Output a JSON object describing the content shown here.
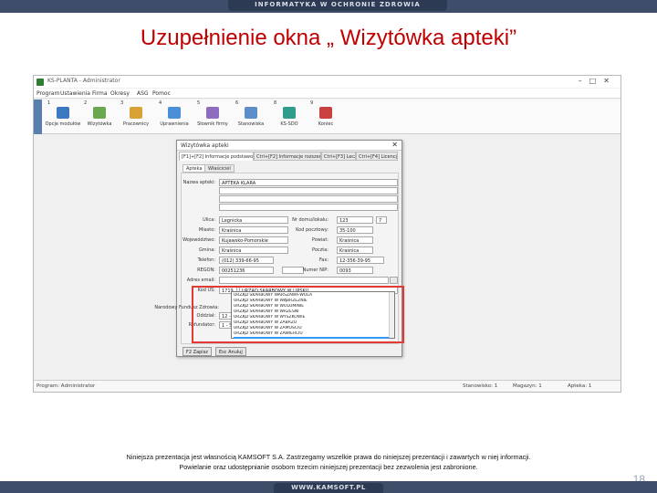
{
  "slide": {
    "header_text": "INFORMATYKA W OCHRONIE ZDROWIA",
    "title": "Uzupełnienie okna „ Wizytówka apteki”",
    "footer_line1": "Niniejsza prezentacja jest własnością KAMSOFT S.A. Zastrzegamy wszelkie prawa do niniejszej prezentacji i zawartych w niej informacji.",
    "footer_line2": "Powielanie oraz udostępnianie osobom trzecim niniejszej prezentacji bez zezwolenia jest zabronione.",
    "bottom_text": "WWW.KAMSOFT.PL",
    "page_number": "18"
  },
  "app": {
    "title": "KS-PLANTA - Administrator",
    "menu": [
      "Program",
      "Ustawienia",
      "Firma",
      "Okresy",
      "ASG",
      "Pomoc"
    ],
    "side_tab": "KS",
    "toolbar": [
      {
        "num": "1",
        "label": "Opcje modułów",
        "color": "#3a78c2"
      },
      {
        "num": "2",
        "label": "Wizytówka",
        "color": "#6aa84f"
      },
      {
        "num": "3",
        "label": "Pracownicy",
        "color": "#d8a236"
      },
      {
        "num": "4",
        "label": "Uprawnienia",
        "color": "#4a90d9"
      },
      {
        "num": "5",
        "label": "Słownik firmy",
        "color": "#8e6cc0"
      },
      {
        "num": "6",
        "label": "Stanowiska",
        "color": "#5c8fc9"
      },
      {
        "num": "8",
        "label": "KS-SDO",
        "color": "#2f9d8a"
      },
      {
        "num": "9",
        "label": "Koniec",
        "color": "#c94040"
      }
    ],
    "status": {
      "left": "Program: Administrator",
      "stanowisko": "Stanowisko: 1",
      "magazyn": "Magazyn: 1",
      "apteka": "Apteka: 1"
    }
  },
  "dialog": {
    "title": "Wizytówka apteki",
    "close": "✕",
    "tabs": [
      "[F1]+[F2] Informacje podstawowe",
      "Ctrl+[F2] Informacje rozszerzone",
      "Ctrl+[F3] Lecz",
      "Ctrl+[F4] Licencja"
    ],
    "subtabs": [
      "Apteka",
      "Właściciel"
    ],
    "fields": {
      "nazwa_label": "Nazwa apteki:",
      "nazwa_value": "APTEKA KLARA",
      "ulica_label": "Ulica:",
      "ulica_value": "Legnicka",
      "nr_label": "Nr domu/lokalu:",
      "nr_value": "123",
      "nr_value2": "7",
      "miasto_label": "Miasto:",
      "miasto_value": "Kraśnica",
      "kod_label": "Kod pocztowy:",
      "kod_value": "35-100",
      "woj_label": "Województwo:",
      "woj_value": "Kujawsko-Pomorskie",
      "powiat_label": "Powiat:",
      "powiat_value": "Kraśnica",
      "gmina_label": "Gmina:",
      "gmina_value": "Kraśnica",
      "poczta_label": "Poczta:",
      "poczta_value": "Kraśnica",
      "tel_label": "Telefon:",
      "tel_value": "(012) 339-66-95",
      "fax_label": "Fax:",
      "fax_value": "12-356-39-95",
      "regon_label": "REGON:",
      "regon_value": "00251236",
      "nip_label": "Numer NIP:",
      "nip_value": "0093",
      "adres_label": "Adres email:",
      "kod_us_label": "Kod US:",
      "kod_us_value": "1719",
      "kod_us_selected": "URZĄD SKARBOWY W LIPSKU",
      "narodowy_label": "Narodowy Fundusz Zdrowia:",
      "oddzial_label": "Oddział:",
      "oddzial_value": "12 - Śl",
      "refund_label": "Refundator:",
      "refund_value": "1 - Śl"
    },
    "dropdown_items": [
      "URZĄD SKARBOWY WARSZAWA-WOLA",
      "URZĄD SKARBOWY W WĄBRZEŹNIE",
      "URZĄD SKARBOWY W WOLOMINIE",
      "URZĄD SKARBOWY W WRZEŚNI",
      "URZĄD SKARBOWY W WYSZKOWIE",
      "URZĄD SKARBOWY W ZABRZU",
      "URZĄD SKARBOWY W ZAMOŚCIU",
      "URZĄD SKARBOWY W ZAWIERCIU",
      "URZĄD SKARBOWY W LIPSKU"
    ],
    "buttons": {
      "save": "F2 Zapisz",
      "cancel": "Esc Anuluj"
    }
  },
  "colors": {
    "title_red": "#c00000",
    "highlight": "#e53935",
    "banner": "#3e4e6a"
  }
}
